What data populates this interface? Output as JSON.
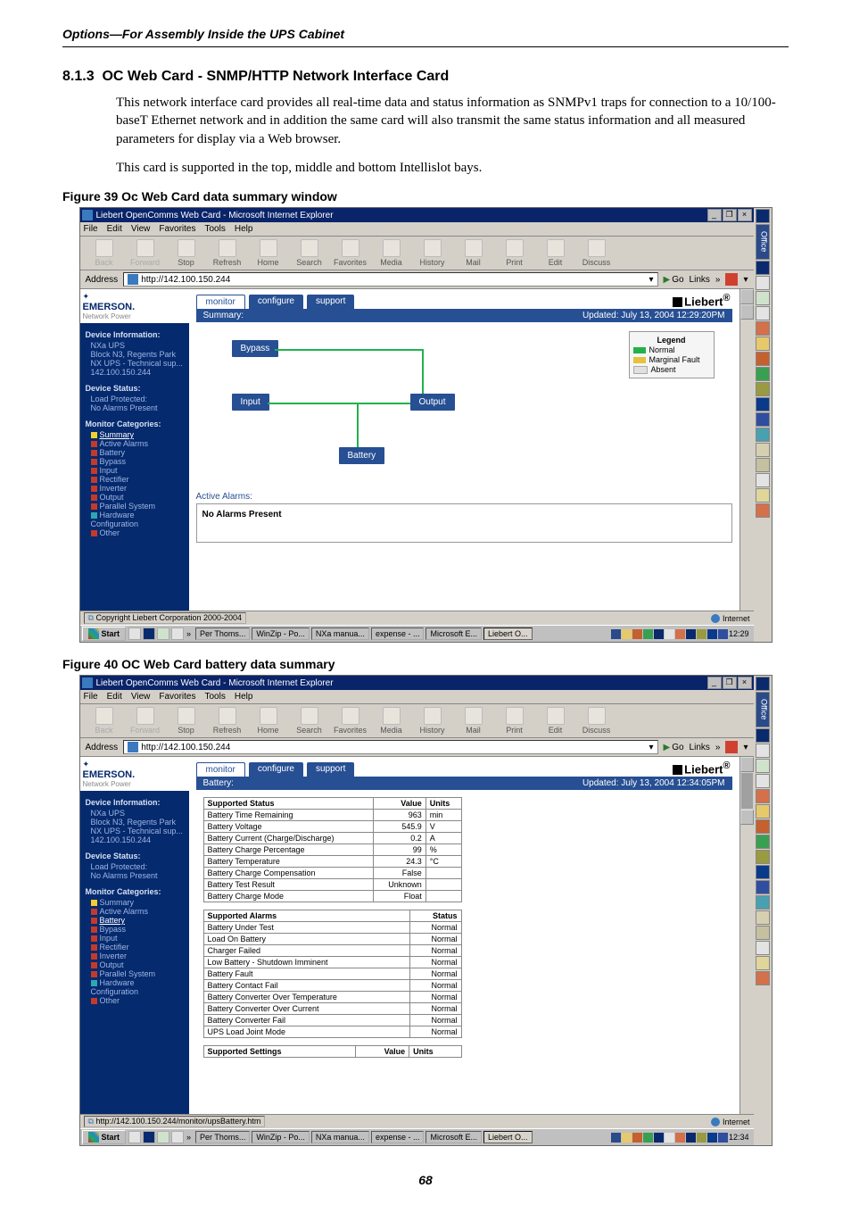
{
  "header": {
    "running": "Options—For Assembly Inside the UPS Cabinet"
  },
  "section": {
    "number": "8.1.3",
    "title": "OC Web Card - SNMP/HTTP Network Interface Card"
  },
  "para1": "This network interface card provides all real-time data and status information as SNMPv1 traps for connection to a 10/100-baseT Ethernet network and in addition the same card will also transmit the same status information and all measured parameters for display via a Web browser.",
  "para2": "This card is supported in the top, middle and bottom Intellislot bays.",
  "fig39": {
    "caption": "Figure 39  Oc Web Card data summary window",
    "title": "Liebert OpenComms Web Card - Microsoft Internet Explorer",
    "url": "http://142.100.150.244",
    "menus": [
      "File",
      "Edit",
      "View",
      "Favorites",
      "Tools",
      "Help"
    ],
    "toolbar": [
      {
        "l": "Back",
        "d": true
      },
      {
        "l": "Forward",
        "d": true
      },
      {
        "l": "Stop"
      },
      {
        "l": "Refresh"
      },
      {
        "l": "Home"
      },
      {
        "l": "Search"
      },
      {
        "l": "Favorites"
      },
      {
        "l": "Media"
      },
      {
        "l": "History"
      },
      {
        "l": "Mail"
      },
      {
        "l": "Print"
      },
      {
        "l": "Edit"
      },
      {
        "l": "Discuss"
      }
    ],
    "addr_label": "Address",
    "go": "Go",
    "links": "Links",
    "brand": "EMERSON.",
    "brand_sub": "Network Power",
    "rightbrand": "Liebert",
    "tabs": [
      "monitor",
      "configure",
      "support"
    ],
    "panel": {
      "title": "Summary:",
      "updated": "Updated: July 13, 2004 12:29:20PM"
    },
    "blocks": {
      "bypass": "Bypass",
      "input": "Input",
      "output": "Output",
      "battery": "Battery"
    },
    "legend": {
      "title": "Legend",
      "normal": "Normal",
      "marginal": "Marginal Fault",
      "absent": "Absent"
    },
    "active_title": "Active Alarms:",
    "active_msg": "No Alarms Present",
    "dev_info": {
      "title": "Device Information:",
      "lines": [
        "NXa UPS",
        "Block N3, Regents Park",
        "NX UPS - Technical sup...",
        "142.100.150.244"
      ]
    },
    "dev_status": {
      "title": "Device Status:",
      "lines": [
        "Load Protected:",
        "No Alarms Present"
      ]
    },
    "mon_cat": {
      "title": "Monitor Categories:",
      "items": [
        {
          "ic": "i-yel",
          "t": "Summary",
          "sel": true
        },
        {
          "ic": "i-red",
          "t": "Active Alarms"
        },
        {
          "ic": "i-red",
          "t": "Battery"
        },
        {
          "ic": "i-red",
          "t": "Bypass"
        },
        {
          "ic": "i-red",
          "t": "Input"
        },
        {
          "ic": "i-red",
          "t": "Rectifier"
        },
        {
          "ic": "i-red",
          "t": "Inverter"
        },
        {
          "ic": "i-red",
          "t": "Output"
        },
        {
          "ic": "i-red",
          "t": "Parallel System"
        },
        {
          "ic": "i-cyan",
          "t": "Hardware Configuration"
        },
        {
          "ic": "i-red",
          "t": "Other"
        }
      ]
    },
    "status_left": "Copyright Liebert Corporation 2000-2004",
    "status_right": "Internet",
    "task": {
      "items": [
        "Per Thoms...",
        "WinZip - Po...",
        "NXa manua...",
        "expense - ...",
        "Microsoft E...",
        "Liebert O..."
      ],
      "time": "12:29"
    }
  },
  "fig40": {
    "caption": "Figure 40  OC Web Card battery data summary",
    "title": "Liebert OpenComms Web Card - Microsoft Internet Explorer",
    "url": "http://142.100.150.244",
    "status_url": "http://142.100.150.244/monitor/upsBattery.htm",
    "panel": {
      "title": "Battery:",
      "updated": "Updated: July 13, 2004 12:34:05PM"
    },
    "tbl_status": {
      "h1": "Supported Status",
      "h2": "Value",
      "h3": "Units",
      "rows": [
        [
          "Battery Time Remaining",
          "963",
          "min"
        ],
        [
          "Battery Voltage",
          "545.9",
          "V"
        ],
        [
          "Battery Current (Charge/Discharge)",
          "0.2",
          "A"
        ],
        [
          "Battery Charge Percentage",
          "99",
          "%"
        ],
        [
          "Battery Temperature",
          "24.3",
          "°C"
        ],
        [
          "Battery Charge Compensation",
          "False",
          ""
        ],
        [
          "Battery Test Result",
          "Unknown",
          ""
        ],
        [
          "Battery Charge Mode",
          "Float",
          ""
        ]
      ]
    },
    "tbl_alarms": {
      "h1": "Supported Alarms",
      "h2": "Status",
      "rows": [
        [
          "Battery Under Test",
          "Normal"
        ],
        [
          "Load On Battery",
          "Normal"
        ],
        [
          "Charger Failed",
          "Normal"
        ],
        [
          "Low Battery - Shutdown Imminent",
          "Normal"
        ],
        [
          "Battery Fault",
          "Normal"
        ],
        [
          "Battery Contact Fail",
          "Normal"
        ],
        [
          "Battery Converter Over Temperature",
          "Normal"
        ],
        [
          "Battery Converter Over Current",
          "Normal"
        ],
        [
          "Battery Converter Fail",
          "Normal"
        ],
        [
          "UPS Load Joint Mode",
          "Normal"
        ]
      ]
    },
    "tbl_settings": {
      "h1": "Supported Settings",
      "h2": "Value",
      "h3": "Units"
    },
    "mon_cat": {
      "title": "Monitor Categories:",
      "items": [
        {
          "ic": "i-yel",
          "t": "Summary"
        },
        {
          "ic": "i-red",
          "t": "Active Alarms"
        },
        {
          "ic": "i-red",
          "t": "Battery",
          "sel": true
        },
        {
          "ic": "i-red",
          "t": "Bypass"
        },
        {
          "ic": "i-red",
          "t": "Input"
        },
        {
          "ic": "i-red",
          "t": "Rectifier"
        },
        {
          "ic": "i-red",
          "t": "Inverter"
        },
        {
          "ic": "i-red",
          "t": "Output"
        },
        {
          "ic": "i-red",
          "t": "Parallel System"
        },
        {
          "ic": "i-cyan",
          "t": "Hardware Configuration"
        },
        {
          "ic": "i-red",
          "t": "Other"
        }
      ]
    },
    "status_right": "Internet",
    "time": "12:34"
  },
  "pagenum": "68"
}
